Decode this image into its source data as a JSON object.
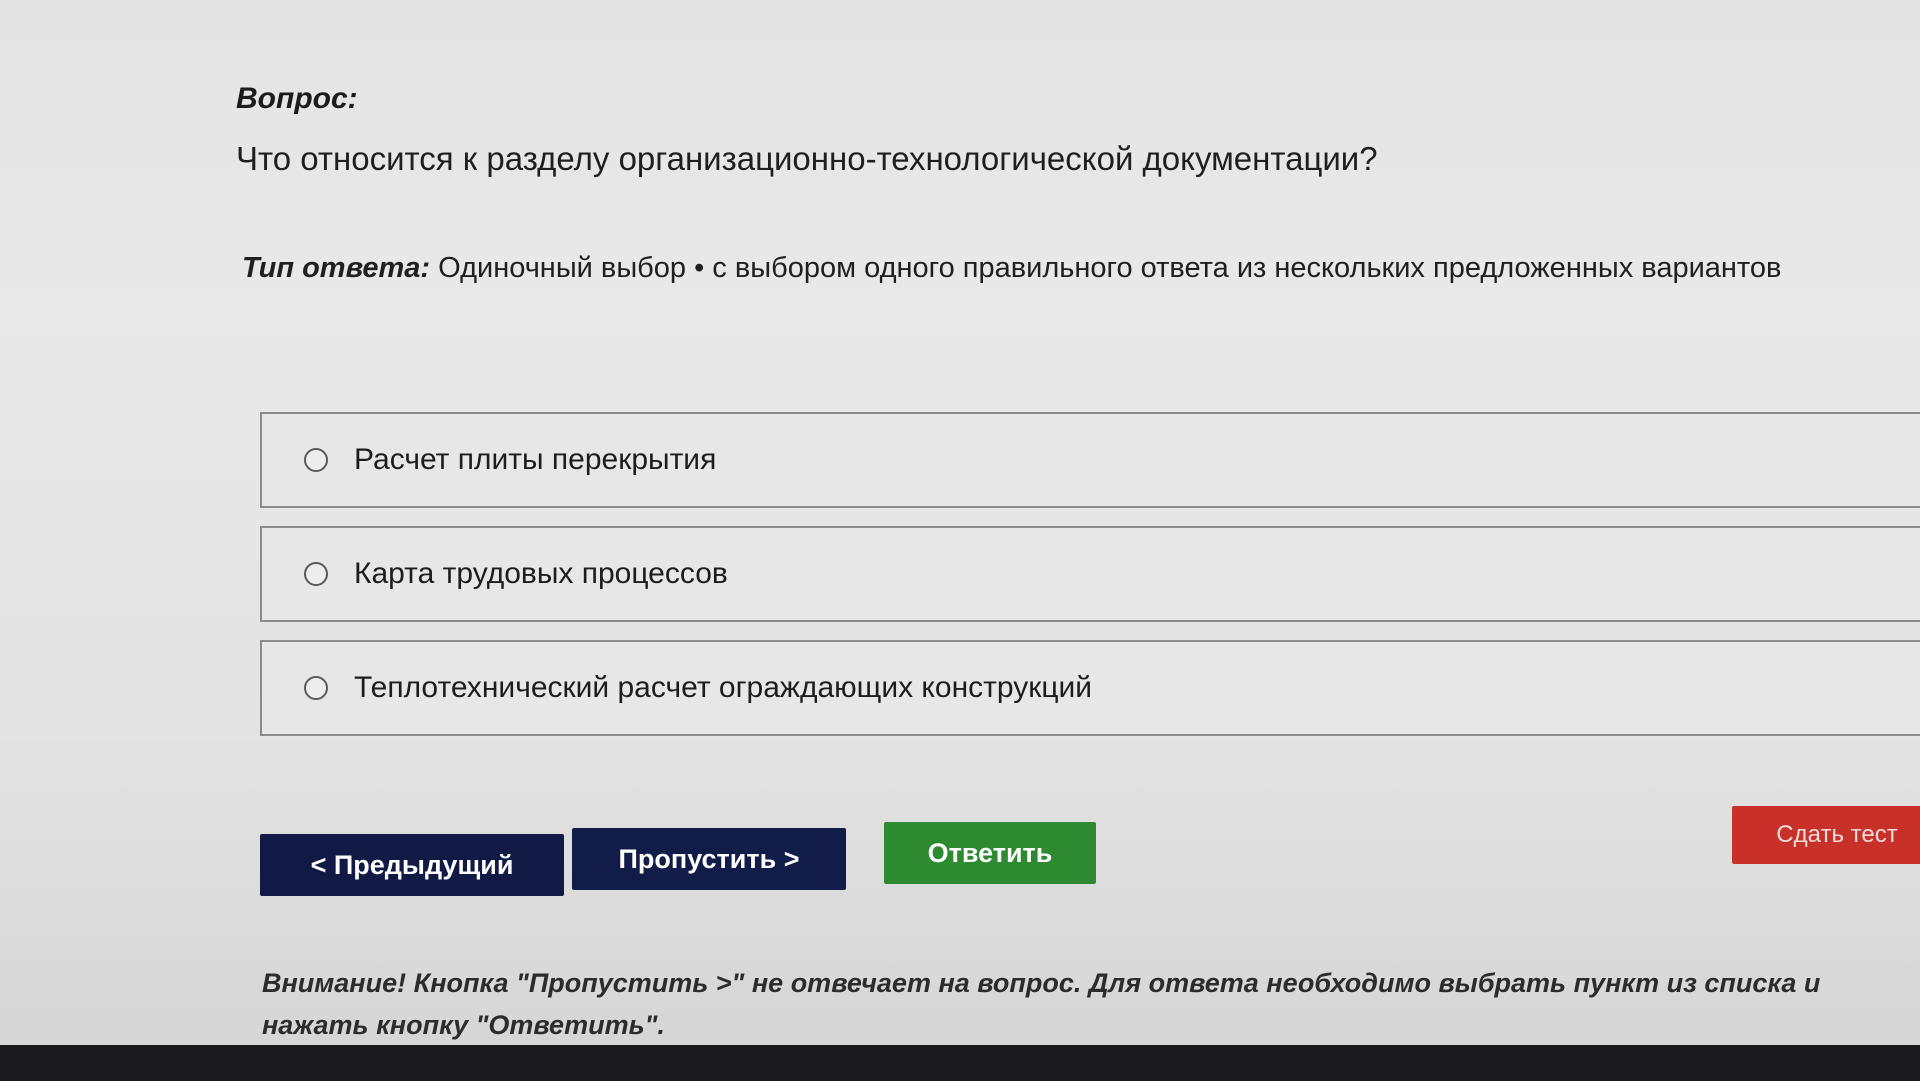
{
  "question": {
    "label": "Вопрос:",
    "text": "Что относится к разделу организационно-технологической документации?"
  },
  "answer_type": {
    "label": "Тип ответа:",
    "value": "Одиночный выбор • с выбором одного правильного ответа из нескольких предложенных вариантов"
  },
  "options": [
    {
      "label": "Расчет плиты перекрытия",
      "selected": false
    },
    {
      "label": "Карта трудовых процессов",
      "selected": false
    },
    {
      "label": "Теплотехнический расчет ограждающих конструкций",
      "selected": false
    }
  ],
  "buttons": {
    "prev": "< Предыдущий",
    "skip": "Пропустить >",
    "answer": "Ответить",
    "submit": "Сдать тест"
  },
  "warning": "Внимание! Кнопка \"Пропустить >\" не отвечает на вопрос. Для ответа необходимо выбрать пункт из списка и нажать кнопку \"Ответить\".",
  "colors": {
    "nav_button": "#101a45",
    "answer_button": "#2e8a31",
    "submit_button": "#c8302a"
  }
}
